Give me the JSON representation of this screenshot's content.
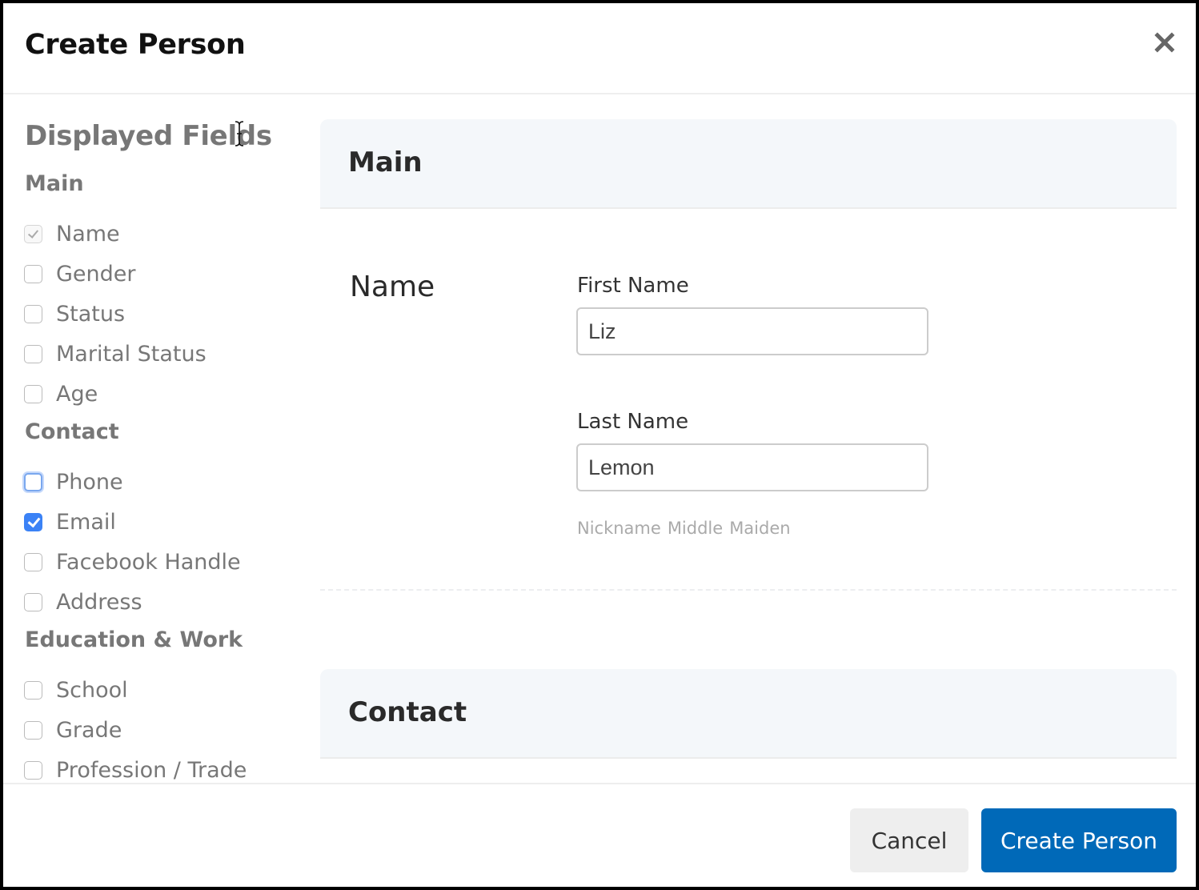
{
  "modal": {
    "title": "Create Person",
    "close_icon": "close-icon"
  },
  "sidebar": {
    "title": "Displayed Fields",
    "groups": [
      {
        "label": "Main",
        "fields": [
          {
            "label": "Name",
            "state": "checked-disabled"
          },
          {
            "label": "Gender",
            "state": "unchecked"
          },
          {
            "label": "Status",
            "state": "unchecked"
          },
          {
            "label": "Marital Status",
            "state": "unchecked"
          },
          {
            "label": "Age",
            "state": "unchecked"
          }
        ]
      },
      {
        "label": "Contact",
        "fields": [
          {
            "label": "Phone",
            "state": "unchecked-focused"
          },
          {
            "label": "Email",
            "state": "checked"
          },
          {
            "label": "Facebook Handle",
            "state": "unchecked"
          },
          {
            "label": "Address",
            "state": "unchecked"
          }
        ]
      },
      {
        "label": "Education & Work",
        "fields": [
          {
            "label": "School",
            "state": "unchecked"
          },
          {
            "label": "Grade",
            "state": "unchecked"
          },
          {
            "label": "Profession / Trade",
            "state": "unchecked"
          }
        ]
      }
    ]
  },
  "main": {
    "sections": [
      {
        "title": "Main"
      },
      {
        "title": "Contact"
      }
    ],
    "name_group": {
      "label": "Name",
      "first_name": {
        "label": "First Name",
        "value": "Liz"
      },
      "last_name": {
        "label": "Last Name",
        "value": "Lemon"
      },
      "extra_links": [
        "Nickname",
        "Middle",
        "Maiden"
      ]
    }
  },
  "footer": {
    "cancel_label": "Cancel",
    "submit_label": "Create Person"
  },
  "colors": {
    "primary": "#0069b8",
    "checkbox_checked": "#3b82f6",
    "section_header_bg": "#f4f7fa"
  }
}
